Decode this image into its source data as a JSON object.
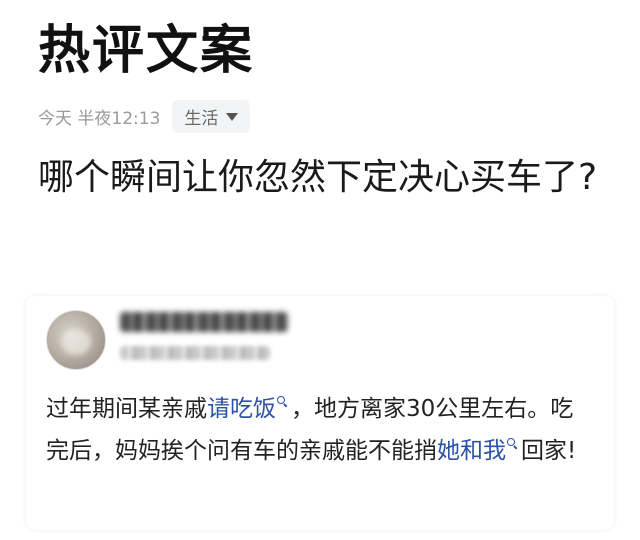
{
  "page": {
    "title": "热评文案"
  },
  "meta": {
    "time": "今天 半夜12:13",
    "category": "生活"
  },
  "question": {
    "text": "哪个瞬间让你忽然下定决心买车了?"
  },
  "comment": {
    "segments": {
      "s1": "过年期间某亲戚",
      "link1": "请吃饭",
      "s2": "，地方离家30公里左右。吃完后，妈妈挨个问有车的亲戚能不能捎",
      "link2": "她和我",
      "s3": "回家!"
    }
  },
  "colors": {
    "link": "#2c52a7",
    "text": "#1a1a1a",
    "meta": "#9a9a9a"
  }
}
